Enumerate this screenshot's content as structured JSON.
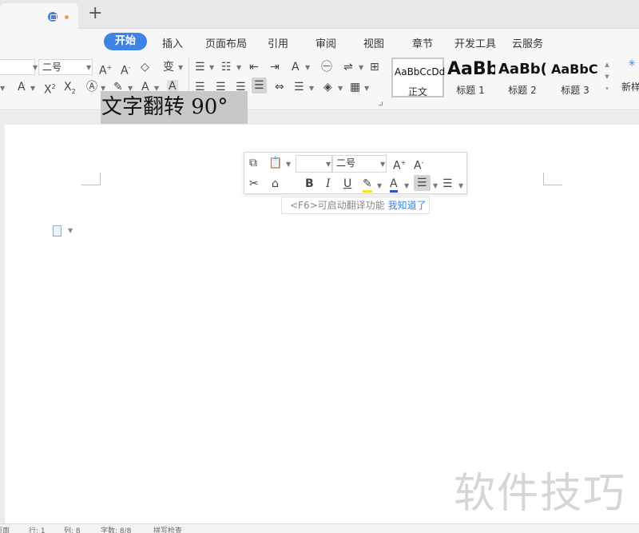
{
  "tabbar": {
    "new_tab_glyph": "+"
  },
  "menu": {
    "tabs": [
      {
        "label": "开始",
        "active": true
      },
      {
        "label": "插入"
      },
      {
        "label": "页面布局"
      },
      {
        "label": "引用"
      },
      {
        "label": "审阅"
      },
      {
        "label": "视图"
      },
      {
        "label": "章节"
      },
      {
        "label": "开发工具"
      },
      {
        "label": "云服务"
      }
    ]
  },
  "ribbon": {
    "font_size_value": "二号",
    "styles": [
      {
        "sample": "AaBbCcDd",
        "label": "正文"
      },
      {
        "sample": "AaBb",
        "label": "标题 1"
      },
      {
        "sample": "AaBb(",
        "label": "标题 2"
      },
      {
        "sample": "AaBbC",
        "label": "标题 3"
      }
    ],
    "new_style_label": "新样"
  },
  "document": {
    "selected_text": "文字翻转 90°"
  },
  "mini_toolbar": {
    "font_size_value": "二号",
    "hint_text": "<F6>可启动翻译功能",
    "hint_link": "我知道了"
  },
  "watermark": "软件技巧",
  "status": {
    "page": "页面",
    "row": "行: 1",
    "col": "列: 8",
    "words": "字数: 8/8",
    "spell": "拼写检查"
  },
  "colors": {
    "accent": "#3f84e5",
    "selection": "#c8c8c8"
  }
}
